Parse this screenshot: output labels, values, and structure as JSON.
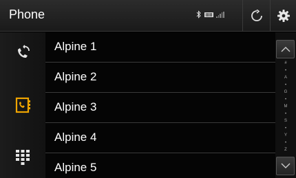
{
  "header": {
    "title": "Phone",
    "icons": [
      "bluetooth-icon",
      "battery-icon",
      "signal-icon"
    ],
    "refresh_icon": "refresh-icon",
    "settings_icon": "gear-icon"
  },
  "sidebar": {
    "items": [
      {
        "name": "recent-calls",
        "icon": "recent-calls-icon"
      },
      {
        "name": "contacts",
        "icon": "contacts-icon",
        "active": true
      },
      {
        "name": "keypad",
        "icon": "keypad-icon"
      }
    ]
  },
  "contacts": [
    {
      "label": "Alpine 1"
    },
    {
      "label": "Alpine 2"
    },
    {
      "label": "Alpine 3"
    },
    {
      "label": "Alpine 4"
    },
    {
      "label": "Alpine 5"
    }
  ],
  "index_bar": {
    "letters": [
      "#",
      "•",
      "A",
      "•",
      "G",
      "•",
      "M",
      "•",
      "S",
      "•",
      "Y",
      "•",
      "Z"
    ],
    "up_icon": "chevron-up-icon",
    "down_icon": "chevron-down-icon"
  },
  "colors": {
    "accent": "#f0a500",
    "background": "#000000",
    "divider": "#3a3a3a"
  }
}
